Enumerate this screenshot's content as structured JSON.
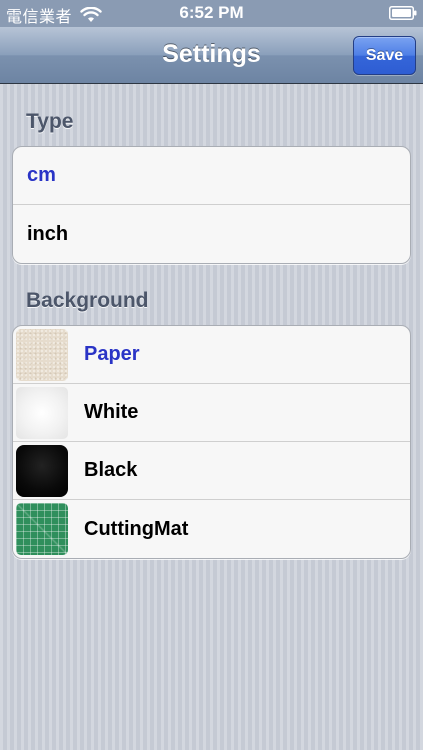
{
  "status_bar": {
    "carrier": "電信業者",
    "time": "6:52 PM",
    "wifi_icon": "wifi-icon",
    "battery_icon": "battery-icon"
  },
  "nav": {
    "title": "Settings",
    "save_label": "Save"
  },
  "type_section": {
    "header": "Type",
    "items": [
      {
        "label": "cm",
        "selected": true
      },
      {
        "label": "inch",
        "selected": false
      }
    ]
  },
  "background_section": {
    "header": "Background",
    "items": [
      {
        "label": "Paper",
        "selected": true,
        "thumb": "paper-texture"
      },
      {
        "label": "White",
        "selected": false,
        "thumb": "white-texture"
      },
      {
        "label": "Black",
        "selected": false,
        "thumb": "black-texture"
      },
      {
        "label": "CuttingMat",
        "selected": false,
        "thumb": "cutting-mat-texture"
      }
    ]
  },
  "colors": {
    "selected_text": "#2a34c6",
    "save_button": "#3566d9",
    "nav_bar": "#7b91ae"
  }
}
